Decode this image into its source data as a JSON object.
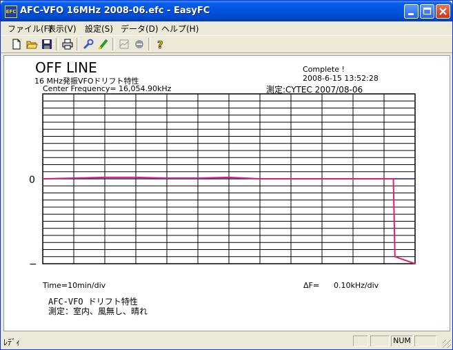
{
  "window": {
    "title": "AFC-VFO 16MHz 2008-06.efc - EasyFC",
    "icon_label": "EFC"
  },
  "menu": [
    "ファイル(F)",
    "表示(V)",
    "設定(S)",
    "データ(D)",
    "ヘルプ(H)"
  ],
  "toolbar": {
    "icons": [
      "new-file-icon",
      "open-folder-icon",
      "save-icon",
      "print-icon",
      "wrench-icon",
      "highlighter-icon",
      "graph-icon",
      "stop-icon",
      "help-icon"
    ]
  },
  "display": {
    "mode": "OFF LINE",
    "subtitle": "16  MHz発振VFOドリフト特性",
    "center_frequency": "Center Frequency= 16,054.90kHz",
    "status": "Complete !",
    "timestamp": "2008-6-15  13:52:28",
    "measured_by": "測定:CYTEC  2007/08-06",
    "zero_label": "0",
    "minus_label": "−",
    "time_scale": "Time=10min/div",
    "delta_f_label": "ΔF=",
    "delta_f_value": "0.10kHz/div",
    "note_line1": "AFC-VFO  ドリフト特性",
    "note_line2": "測定：室内、風無し、晴れ"
  },
  "chart_data": {
    "type": "line",
    "xlabel": "Time=10min/div",
    "ylabel": "ΔF= 0.10kHz/div",
    "grid": true,
    "x_divisions": 12,
    "y_divisions": 24,
    "series": [
      {
        "color": "#e0206f",
        "x": [
          0,
          1,
          2,
          3,
          4,
          5,
          6,
          7,
          8,
          9,
          10,
          11,
          11.3,
          11.35,
          12
        ],
        "y": [
          0,
          0.01,
          0.02,
          0.02,
          0.01,
          0.01,
          0.02,
          0,
          0,
          0,
          0,
          0,
          0,
          -1.1,
          -1.2
        ]
      }
    ],
    "reference_line": {
      "y": 0,
      "color": "#1a1a8a"
    }
  },
  "status": {
    "text": "ﾚﾃﾞｨ",
    "num": "NUM"
  }
}
